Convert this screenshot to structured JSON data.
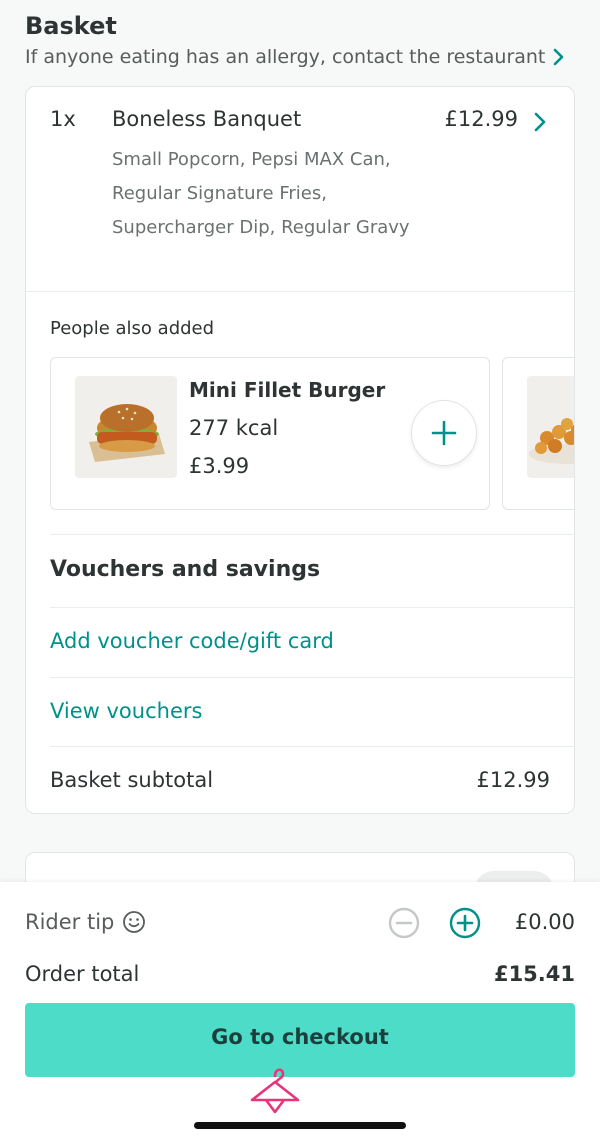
{
  "header": {
    "title": "Basket",
    "allergy_text": "If anyone eating has an allergy, contact the restaurant"
  },
  "item": {
    "qty": "1x",
    "name": "Boneless Banquet",
    "price": "£12.99",
    "description": "Small Popcorn, Pepsi MAX Can, Regular Signature Fries, Supercharger Dip, Regular Gravy"
  },
  "recommendations": {
    "label": "People also added",
    "items": [
      {
        "name": "Mini Fillet Burger",
        "kcal": "277 kcal",
        "price": "£3.99"
      }
    ]
  },
  "vouchers": {
    "title": "Vouchers and savings",
    "add_code": "Add voucher code/gift card",
    "view": "View vouchers"
  },
  "subtotal": {
    "label": "Basket subtotal",
    "value": "£12.99"
  },
  "footer": {
    "tip_label": "Rider tip",
    "tip_value": "£0.00",
    "total_label": "Order total",
    "total_value": "£15.41",
    "checkout_label": "Go to checkout"
  },
  "colors": {
    "accent": "#00918a",
    "checkout_bg": "#4ddcc8",
    "watermark": "#e8347a"
  }
}
